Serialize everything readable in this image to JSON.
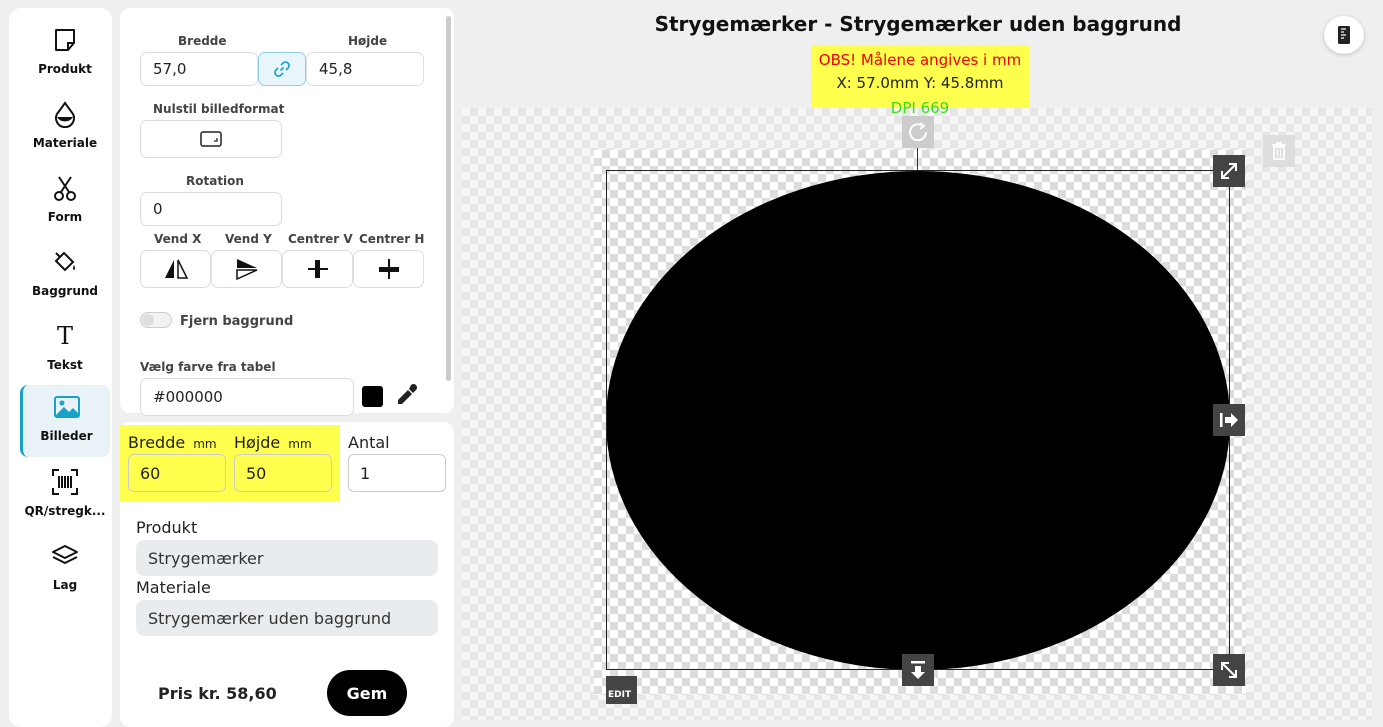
{
  "sidebar": {
    "items": [
      {
        "label": "Produkt",
        "icon": "note-icon"
      },
      {
        "label": "Materiale",
        "icon": "drop-icon"
      },
      {
        "label": "Form",
        "icon": "scissors-icon"
      },
      {
        "label": "Baggrund",
        "icon": "paint-bucket-icon"
      },
      {
        "label": "Tekst",
        "icon": "text-icon"
      },
      {
        "label": "Billeder",
        "icon": "image-icon"
      },
      {
        "label": "QR/stregk...",
        "icon": "barcode-icon"
      },
      {
        "label": "Lag",
        "icon": "layers-icon"
      }
    ],
    "active": "Billeder",
    "accent_color": "#17a2c8"
  },
  "image_props": {
    "width_label": "Bredde",
    "width_value": "57,0",
    "height_label": "Højde",
    "height_value": "45,8",
    "reset_label": "Nulstil billedformat",
    "rotation_label": "Rotation",
    "rotation_value": "0",
    "flip_x_label": "Vend X",
    "flip_y_label": "Vend Y",
    "center_v_label": "Centrer V",
    "center_h_label": "Centrer H",
    "remove_bg_label": "Fjern baggrund",
    "remove_bg_on": false,
    "color_label": "Vælg farve fra tabel",
    "color_value": "#000000"
  },
  "order": {
    "width_label": "Bredde",
    "height_label": "Højde",
    "unit": "mm",
    "width_value": "60",
    "height_value": "50",
    "qty_label": "Antal",
    "qty_value": "1",
    "product_label": "Produkt",
    "product_value": "Strygemærker",
    "material_label": "Materiale",
    "material_value": "Strygemærker uden baggrund",
    "price": "Pris kr. 58,60",
    "save_label": "Gem",
    "highlight_color": "#ffff4d"
  },
  "canvas": {
    "title": "Strygemærker - Strygemærker uden baggrund",
    "notice": "OBS! Målene angives i mm",
    "dimensions": "X: 57.0mm Y: 45.8mm",
    "dpi": "DPI 669",
    "edit_label": "EDIT",
    "shape_color": "#000000"
  }
}
